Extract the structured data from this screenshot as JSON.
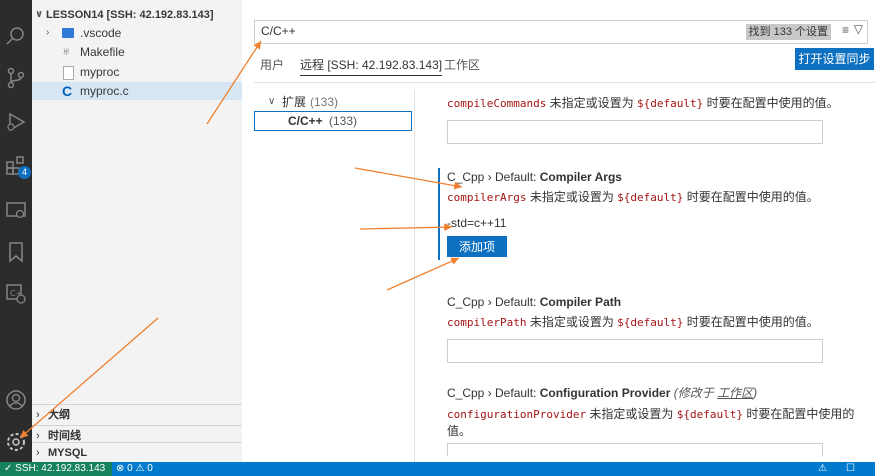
{
  "sidebar": {
    "folder": "LESSON14 [SSH: 42.192.83.143]",
    "items": [
      {
        "label": ".vscode",
        "icon": "vscode-folder-icon"
      },
      {
        "label": "Makefile",
        "icon": "makefile-icon"
      },
      {
        "label": "myproc",
        "icon": "file-icon"
      },
      {
        "label": "myproc.c",
        "icon": "c-file-icon"
      }
    ],
    "sections": [
      "大纲",
      "时间线",
      "MYSQL"
    ]
  },
  "activity": {
    "extensions_badge": "4"
  },
  "search": {
    "query": "C/C++",
    "found": "找到 133 个设置"
  },
  "tabs": [
    "用户",
    "远程 [SSH: 42.192.83.143]",
    "工作区"
  ],
  "sync_button": "打开设置同步",
  "toc": {
    "ext": "扩展",
    "ext_count": "(133)",
    "cpp": "C/C++",
    "cpp_count": "(133)"
  },
  "settings": {
    "compile_commands": {
      "key": "compileCommands",
      "desc": " 未指定或设置为 ",
      "default": "${default}",
      "desc2": " 时要在配置中使用的值。"
    },
    "compiler_args": {
      "prefix": "C_Cpp › Default: ",
      "name": "Compiler Args",
      "key": "compilerArgs",
      "desc": " 未指定或设置为 ",
      "default": "${default}",
      "desc2": " 时要在配置中使用的值。",
      "item": "-std=c++11",
      "add": "添加项"
    },
    "compiler_path": {
      "prefix": "C_Cpp › Default: ",
      "name": "Compiler Path",
      "key": "compilerPath",
      "desc": " 未指定或设置为 ",
      "default": "${default}",
      "desc2": " 时要在配置中使用的值。"
    },
    "config_provider": {
      "prefix": "C_Cpp › Default: ",
      "name": "Configuration Provider",
      "modified": "(修改于 ",
      "modified_link": "工作区",
      "modified_end": ")",
      "key": "configurationProvider",
      "desc": " 未指定或设置为 ",
      "default": "${default}",
      "desc2": " 时要在配置中使用的",
      "desc3": "值。"
    }
  },
  "status": {
    "remote": "SSH: 42.192.83.143",
    "problems": "⊗ 0 ⚠ 0"
  },
  "colors": {
    "accent": "#0e70c0",
    "activity_bg": "#2c2c2c",
    "statusbar": "#007acc",
    "remote": "#16825d",
    "arrow": "#f08030"
  }
}
